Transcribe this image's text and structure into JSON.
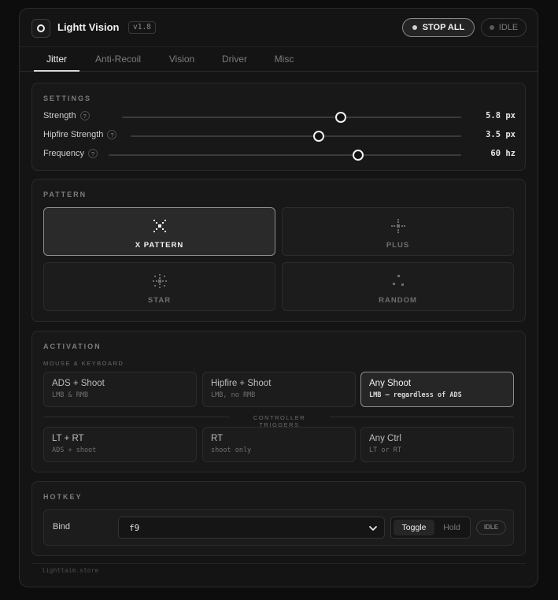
{
  "app": {
    "title": "Lightt Vision",
    "version": "v1.8",
    "stop_all_label": "STOP ALL",
    "status_label": "IDLE"
  },
  "tabs": [
    {
      "label": "Jitter",
      "active": true
    },
    {
      "label": "Anti-Recoil",
      "active": false
    },
    {
      "label": "Vision",
      "active": false
    },
    {
      "label": "Driver",
      "active": false
    },
    {
      "label": "Misc",
      "active": false
    }
  ],
  "settings": {
    "title": "SETTINGS",
    "help_glyph": "?",
    "sliders": [
      {
        "label": "Strength",
        "value_text": "5.8 px",
        "fill": 0.645
      },
      {
        "label": "Hipfire Strength",
        "value_text": "3.5 px",
        "fill": 0.57
      },
      {
        "label": "Frequency",
        "value_text": "60 hz",
        "fill": 0.708
      }
    ]
  },
  "pattern": {
    "title": "PATTERN",
    "options": [
      {
        "label": "X PATTERN",
        "icon": "x-pattern-icon",
        "active": true
      },
      {
        "label": "PLUS",
        "icon": "plus-pattern-icon",
        "active": false
      },
      {
        "label": "STAR",
        "icon": "star-pattern-icon",
        "active": false
      },
      {
        "label": "RANDOM",
        "icon": "random-pattern-icon",
        "active": false
      }
    ]
  },
  "activation": {
    "title": "ACTIVATION",
    "mk_heading": "MOUSE & KEYBOARD",
    "controller_heading": "CONTROLLER TRIGGERS",
    "mk_options": [
      {
        "label": "ADS + Shoot",
        "sub": "LMB & RMB",
        "active": false
      },
      {
        "label": "Hipfire + Shoot",
        "sub": "LMB, no RMB",
        "active": false
      },
      {
        "label": "Any Shoot",
        "sub": "LMB — regardless of ADS",
        "active": true
      }
    ],
    "controller_options": [
      {
        "label": "LT + RT",
        "sub": "ADS + shoot",
        "active": false
      },
      {
        "label": "RT",
        "sub": "shoot only",
        "active": false
      },
      {
        "label": "Any Ctrl",
        "sub": "LT or RT",
        "active": false
      }
    ]
  },
  "hotkey": {
    "title": "HOTKEY",
    "bind_label": "Bind",
    "bind_value": "f9",
    "mode_options": [
      {
        "label": "Toggle",
        "active": true
      },
      {
        "label": "Hold",
        "active": false
      }
    ],
    "status_label": "IDLE"
  },
  "footer": {
    "text": "lighttaim.store"
  },
  "colors": {
    "background": "#141414",
    "panel": "#181818",
    "accent": "#f2f2f2",
    "muted": "#7c7c7c"
  }
}
